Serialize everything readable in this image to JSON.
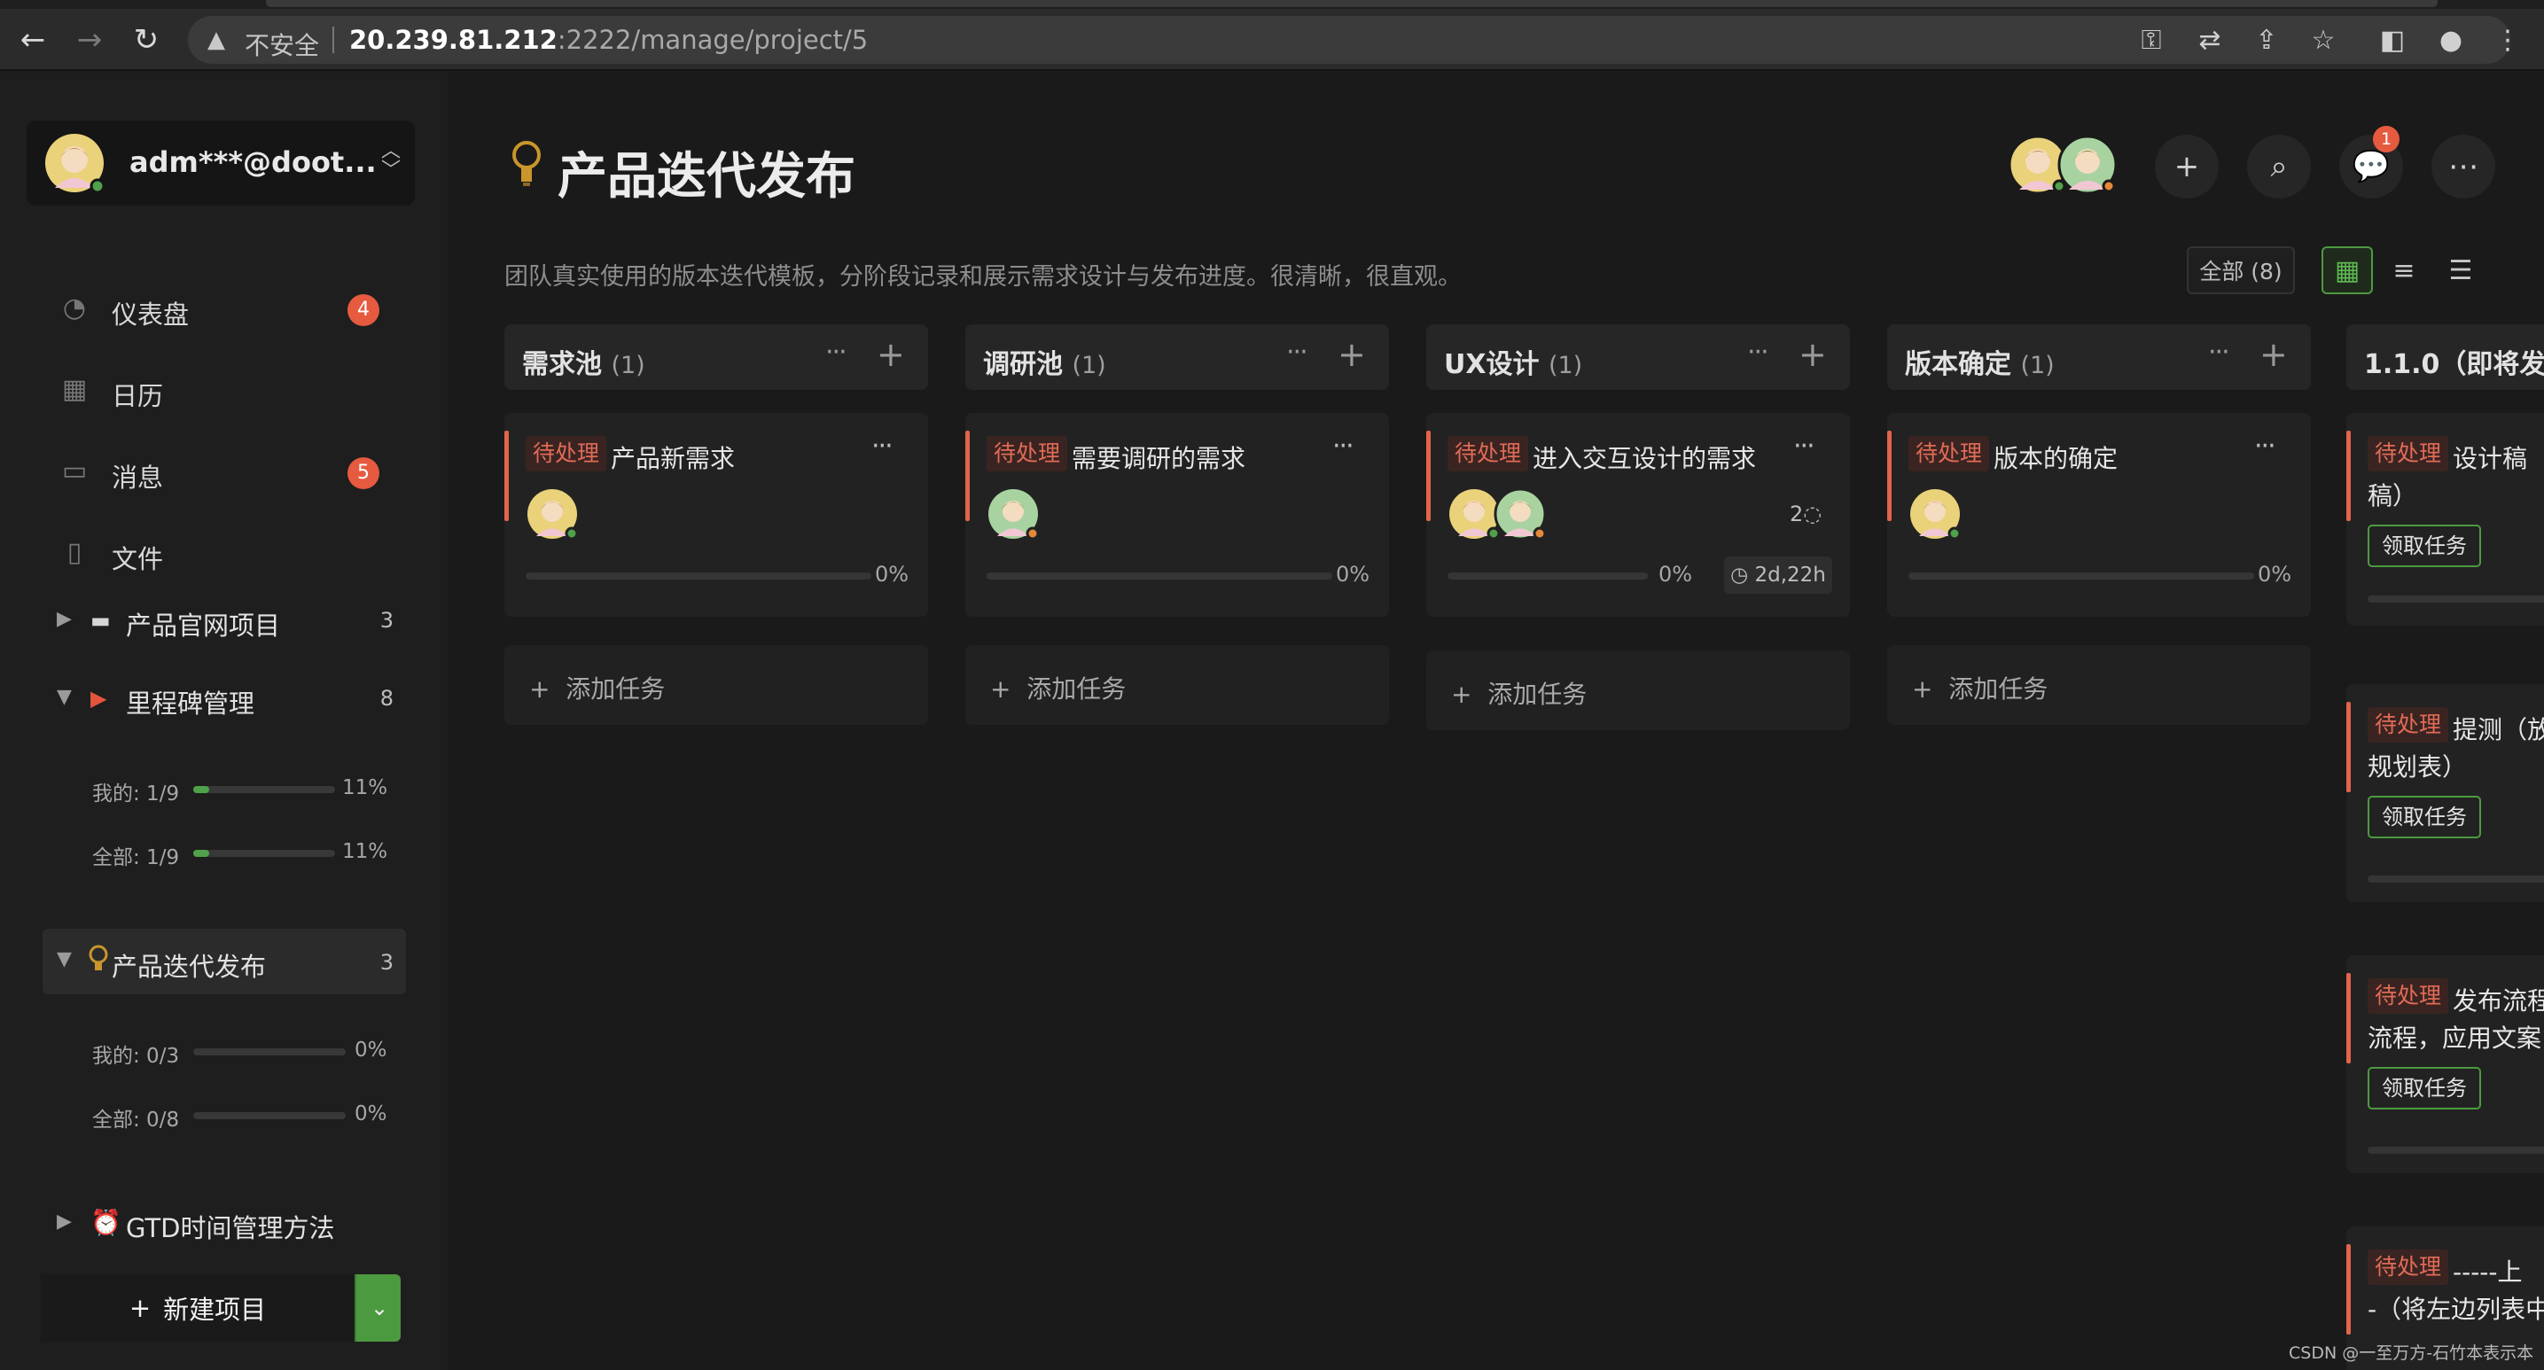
{
  "browser": {
    "insecure_label": "不安全",
    "url_host": "20.239.81.212",
    "url_path": ":2222/manage/project/5"
  },
  "account": {
    "name": "adm***@doot..."
  },
  "nav": [
    {
      "label": "仪表盘",
      "icon": "dashboard-icon",
      "badge": "4"
    },
    {
      "label": "日历",
      "icon": "calendar-icon",
      "badge": ""
    },
    {
      "label": "消息",
      "icon": "message-icon",
      "badge": "5"
    },
    {
      "label": "文件",
      "icon": "file-icon",
      "badge": ""
    }
  ],
  "projects": [
    {
      "emoji": "💻",
      "label": "产品官网项目",
      "count": "3"
    },
    {
      "emoji": "🚩",
      "label": "里程碑管理",
      "count": "8",
      "mine": {
        "label": "我的: 1/9",
        "pct": "11%",
        "value": 0.11
      },
      "all": {
        "label": "全部: 1/9",
        "pct": "11%",
        "value": 0.11
      }
    },
    {
      "emoji": "💡",
      "label": "产品迭代发布",
      "count": "3",
      "mine": {
        "label": "我的: 0/3",
        "pct": "0%",
        "value": 0
      },
      "all": {
        "label": "全部: 0/8",
        "pct": "0%",
        "value": 0
      }
    },
    {
      "emoji": "⏰",
      "label": "GTD时间管理方法",
      "count": ""
    }
  ],
  "new_project_label": "新建项目",
  "page": {
    "title": "产品迭代发布",
    "description": "团队真实使用的版本迭代模板，分阶段记录和展示需求设计与发布进度。很清晰，很直观。",
    "notification_count": "1",
    "filter_label": "全部 (8)"
  },
  "columns": [
    {
      "name": "需求池",
      "count": "(1)",
      "card": {
        "tag": "待处理",
        "title": "产品新需求",
        "pct": "0%",
        "value": 0,
        "comments": "",
        "due": ""
      }
    },
    {
      "name": "调研池",
      "count": "(1)",
      "card": {
        "tag": "待处理",
        "title": "需要调研的需求",
        "pct": "0%",
        "value": 0,
        "comments": "",
        "due": ""
      }
    },
    {
      "name": "UX设计",
      "count": "(1)",
      "card": {
        "tag": "待处理",
        "title": "进入交互设计的需求",
        "pct": "0%",
        "value": 0,
        "comments": "2",
        "due": "2d,22h"
      }
    },
    {
      "name": "版本确定",
      "count": "(1)",
      "card": {
        "tag": "待处理",
        "title": "版本的确定",
        "pct": "0%",
        "value": 0,
        "comments": "",
        "due": ""
      }
    }
  ],
  "add_task_label": "添加任务",
  "partial_column": {
    "name": "1.1.0（即将发布",
    "cards": [
      {
        "tag": "待处理",
        "line1": "设计稿",
        "line2": "稿）",
        "claim": "领取任务"
      },
      {
        "tag": "待处理",
        "line1": "提测（放",
        "line2": "规划表）",
        "claim": "领取任务"
      },
      {
        "tag": "待处理",
        "line1": "发布流程",
        "line2": "流程，应用文案",
        "claim": "领取任务"
      },
      {
        "tag": "待处理",
        "line1": "-----上",
        "line2": "-（将左边列表中",
        "claim": ""
      }
    ]
  },
  "watermark": "CSDN @一至万方-石竹本表示本"
}
